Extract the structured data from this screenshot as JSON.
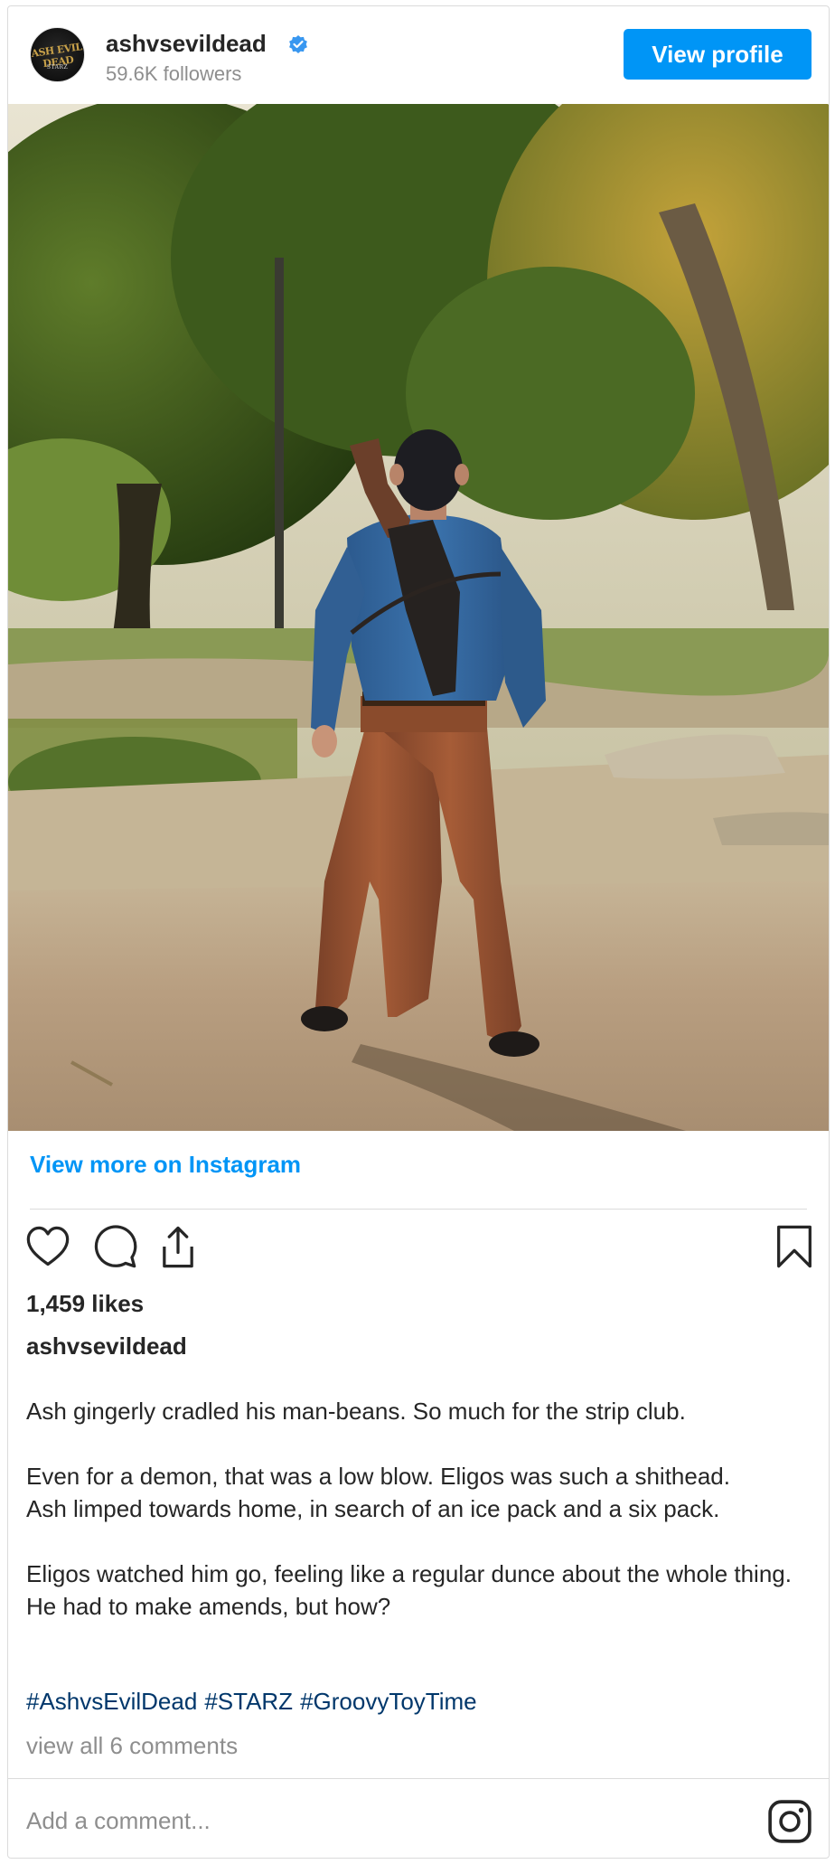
{
  "header": {
    "username": "ashvsevildead",
    "followers": "59.6K followers",
    "view_profile_label": "View profile",
    "avatar_logo_top": "ASH EVIL DEAD",
    "avatar_logo_bottom": "STARZ"
  },
  "post": {
    "view_more_label": "View more on Instagram",
    "likes": "1,459 likes",
    "caption_user": "ashvsevildead",
    "caption_paragraphs": [
      [
        "Ash gingerly cradled his man-beans. So much for the strip club."
      ],
      [
        "Even for a demon, that was a low blow. Eligos was such a shithead.",
        "Ash limped towards home, in search of an ice pack and a six pack."
      ],
      [
        "Eligos watched him go, feeling like a regular dunce about the whole thing.",
        "He had to make amends, but how?"
      ]
    ],
    "hashtags": [
      "#AshvsEvilDead",
      "#STARZ",
      "#GroovyToyTime"
    ],
    "view_comments": "view all 6 comments",
    "add_comment_placeholder": "Add a comment..."
  },
  "icons": {
    "verified": "verified-badge-icon",
    "like": "heart-icon",
    "comment": "comment-bubble-icon",
    "share": "share-icon",
    "save": "bookmark-icon",
    "instagram": "instagram-logo-icon"
  },
  "colors": {
    "accent": "#0095f6",
    "hashtag": "#00376b",
    "muted": "#8e8e8e",
    "text": "#262626"
  }
}
